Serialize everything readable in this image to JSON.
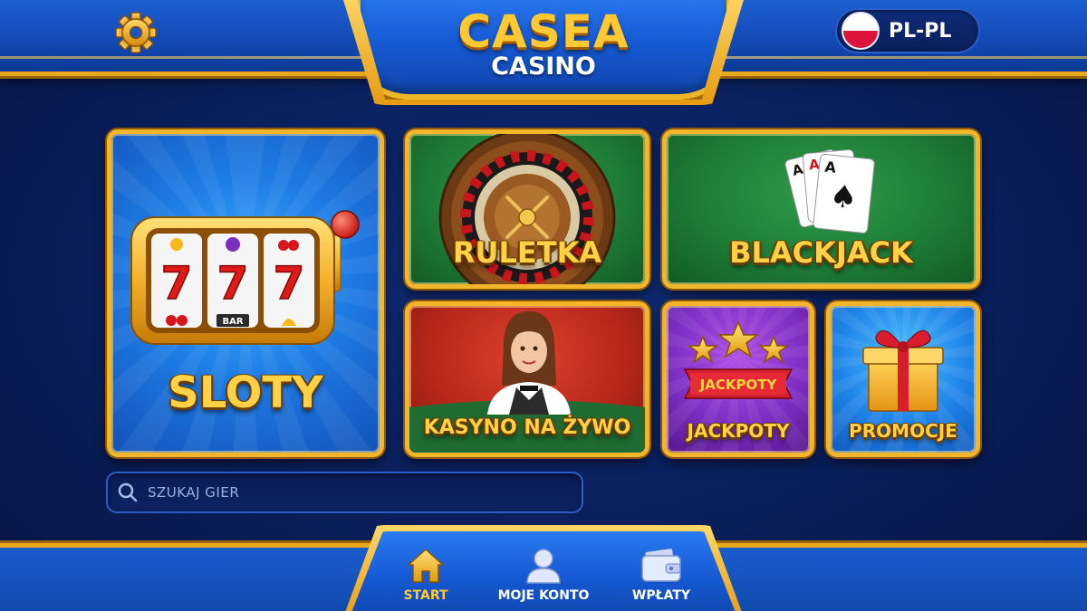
{
  "header": {
    "logo_title": "CASEA",
    "logo_subtitle": "CASINO",
    "language": {
      "code": "PL-PL",
      "flag": "poland-flag"
    },
    "settings_icon": "gear-icon"
  },
  "tiles": {
    "sloty": {
      "label": "SLOTY",
      "icon": "slot-machine-icon",
      "reel_symbols": [
        "7",
        "7",
        "7"
      ],
      "reel_labels": [
        "BAR"
      ]
    },
    "ruletka": {
      "label": "RULETKA",
      "icon": "roulette-wheel-icon"
    },
    "blackjack": {
      "label": "BLACKJACK",
      "icon": "playing-cards-icon"
    },
    "live": {
      "label": "KASYNO NA ŻYWO",
      "icon": "live-dealer-icon"
    },
    "jackpoty": {
      "label": "JACKPOTY",
      "icon": "jackpot-stars-icon",
      "ribbon_text": "JACKPOTY"
    },
    "promocje": {
      "label": "PROMOCJE",
      "icon": "gift-box-icon"
    }
  },
  "search": {
    "placeholder": "SZUKAJ GIER",
    "value": ""
  },
  "bottom_nav": {
    "items": [
      {
        "label": "START",
        "icon": "home-icon",
        "active": true
      },
      {
        "label": "MOJE KONTO",
        "icon": "user-icon",
        "active": false
      },
      {
        "label": "WPŁATY",
        "icon": "wallet-icon",
        "active": false
      }
    ]
  },
  "colors": {
    "gold": "#f2b52b",
    "gold_text": "#ffd245",
    "navy_bg": "#0a1c4e",
    "header_blue": "#1c5fd0",
    "tile_green": "#1d7a35",
    "tile_red": "#b5261a",
    "tile_purple": "#7e2fc4",
    "tile_blue": "#1e7de6"
  }
}
